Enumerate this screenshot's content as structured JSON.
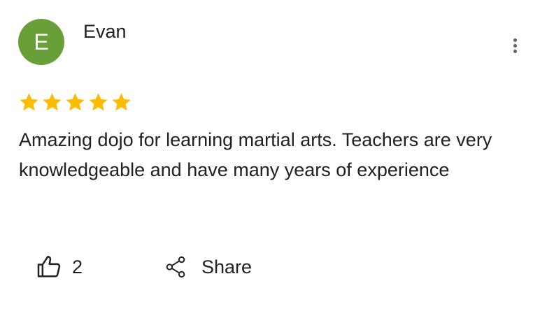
{
  "review": {
    "avatar_initial": "E",
    "avatar_color": "#689f38",
    "author": "Evan",
    "rating": 5,
    "rating_max": 5,
    "star_color": "#fbbc04",
    "text": "Amazing dojo for learning martial arts. Teachers are very knowledgeable and have many years of experience",
    "likes": "2",
    "share_label": "Share"
  },
  "icons": {
    "menu": "more-vert-icon",
    "like": "thumb-up-outline-icon",
    "share": "share-icon",
    "star": "star-icon"
  }
}
